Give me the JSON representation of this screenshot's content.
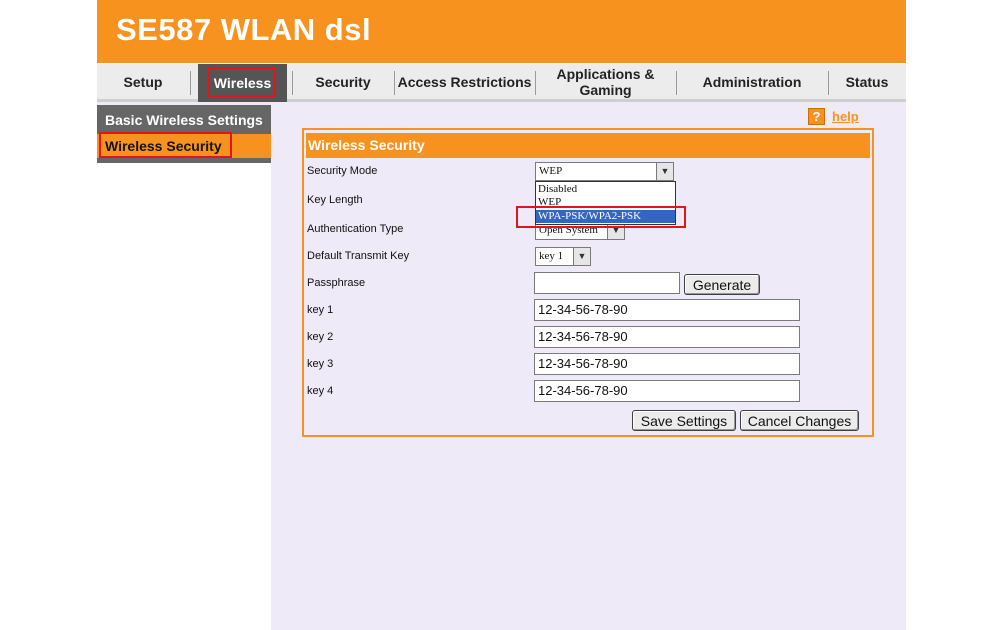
{
  "app": {
    "title": "SE587 WLAN dsl"
  },
  "nav": {
    "tabs": [
      {
        "label": "Setup"
      },
      {
        "label": "Wireless"
      },
      {
        "label": "Security"
      },
      {
        "label": "Access Restrictions"
      },
      {
        "label_line1": "Applications &",
        "label_line2": "Gaming"
      },
      {
        "label": "Administration"
      },
      {
        "label": "Status"
      }
    ],
    "active_tab": "Wireless"
  },
  "sidebar": {
    "items": [
      {
        "label": "Basic Wireless Settings"
      },
      {
        "label": "Wireless Security"
      }
    ],
    "current": "Wireless Security"
  },
  "help": {
    "label": "help",
    "icon": "question-mark-icon"
  },
  "panel": {
    "title": "Wireless Security",
    "fields": {
      "security_mode": {
        "label": "Security Mode",
        "value": "WEP"
      },
      "key_length": {
        "label": "Key Length"
      },
      "auth_type": {
        "label": "Authentication Type",
        "value": "Open System"
      },
      "default_key": {
        "label": "Default Transmit Key",
        "value": "key 1"
      },
      "passphrase": {
        "label": "Passphrase",
        "value": "",
        "button": "Generate"
      },
      "keys": [
        {
          "label": "key 1",
          "value": "12-34-56-78-90"
        },
        {
          "label": "key 2",
          "value": "12-34-56-78-90"
        },
        {
          "label": "key 3",
          "value": "12-34-56-78-90"
        },
        {
          "label": "key 4",
          "value": "12-34-56-78-90"
        }
      ]
    },
    "dropdown_options": [
      "Disabled",
      "WEP",
      "WPA-PSK/WPA2-PSK"
    ],
    "dropdown_highlighted": "WPA-PSK/WPA2-PSK",
    "buttons": {
      "save": "Save Settings",
      "cancel": "Cancel Changes"
    }
  },
  "colors": {
    "brand_orange": "#f7921e",
    "highlight_red": "#e2141c",
    "selection_blue": "#3166c4",
    "background": "#efeaf8"
  }
}
